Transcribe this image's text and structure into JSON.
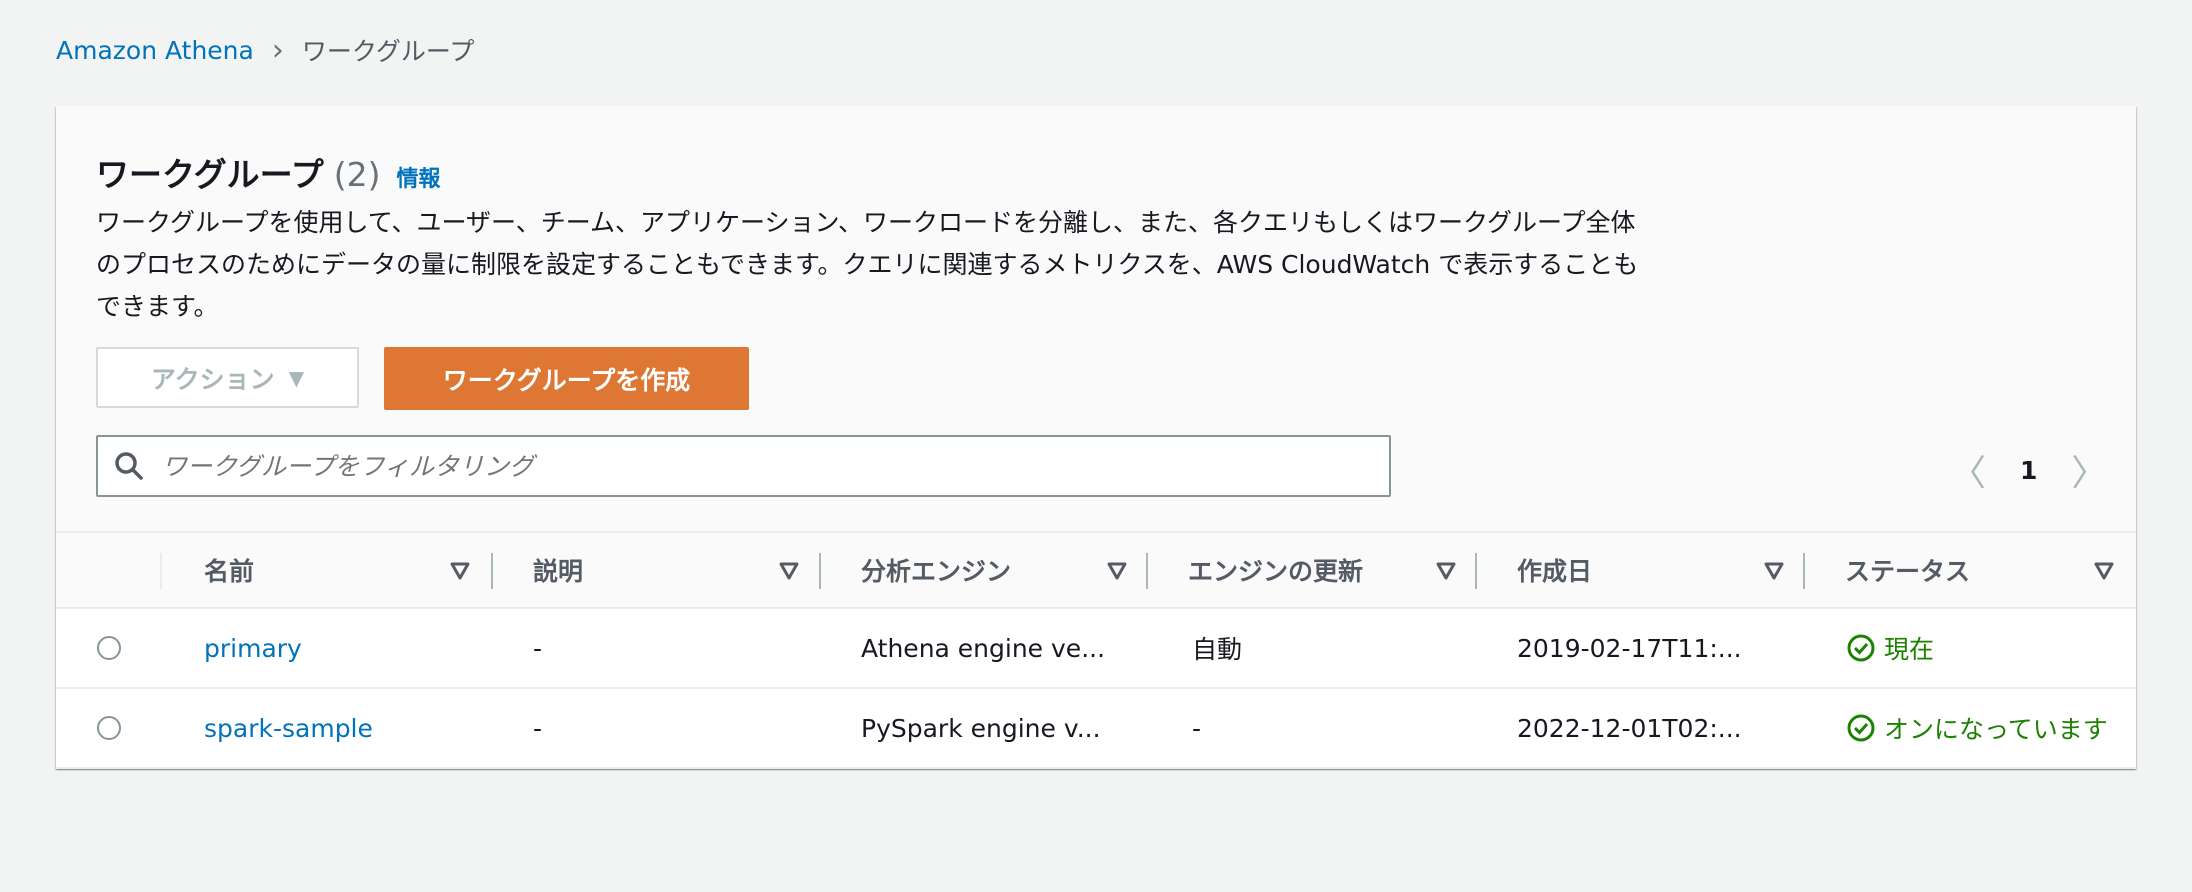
{
  "breadcrumb": {
    "root": "Amazon Athena",
    "current": "ワークグループ"
  },
  "panel": {
    "title": "ワークグループ",
    "count": "(2)",
    "info_link": "情報",
    "description": "ワークグループを使用して、ユーザー、チーム、アプリケーション、ワークロードを分離し、また、各クエリもしくはワークグループ全体のプロセスのためにデータの量に制限を設定することもできます。クエリに関連するメトリクスを、AWS CloudWatch で表示することもできます。",
    "actions_label": "アクション",
    "create_label": "ワークグループを作成",
    "search_placeholder": "ワークグループをフィルタリング",
    "page": "1"
  },
  "table": {
    "columns": [
      "名前",
      "説明",
      "分析エンジン",
      "エンジンの更新",
      "作成日",
      "ステータス"
    ],
    "rows": [
      {
        "name": "primary",
        "description": "-",
        "engine": "Athena engine ve...",
        "update": "自動",
        "created": "2019-02-17T11:...",
        "status": "現在"
      },
      {
        "name": "spark-sample",
        "description": "-",
        "engine": "PySpark engine v...",
        "update": "-",
        "created": "2022-12-01T02:...",
        "status": "オンになっています"
      }
    ]
  },
  "colors": {
    "accent": "#dd7733",
    "link": "#0073bb",
    "success": "#1d8102"
  }
}
